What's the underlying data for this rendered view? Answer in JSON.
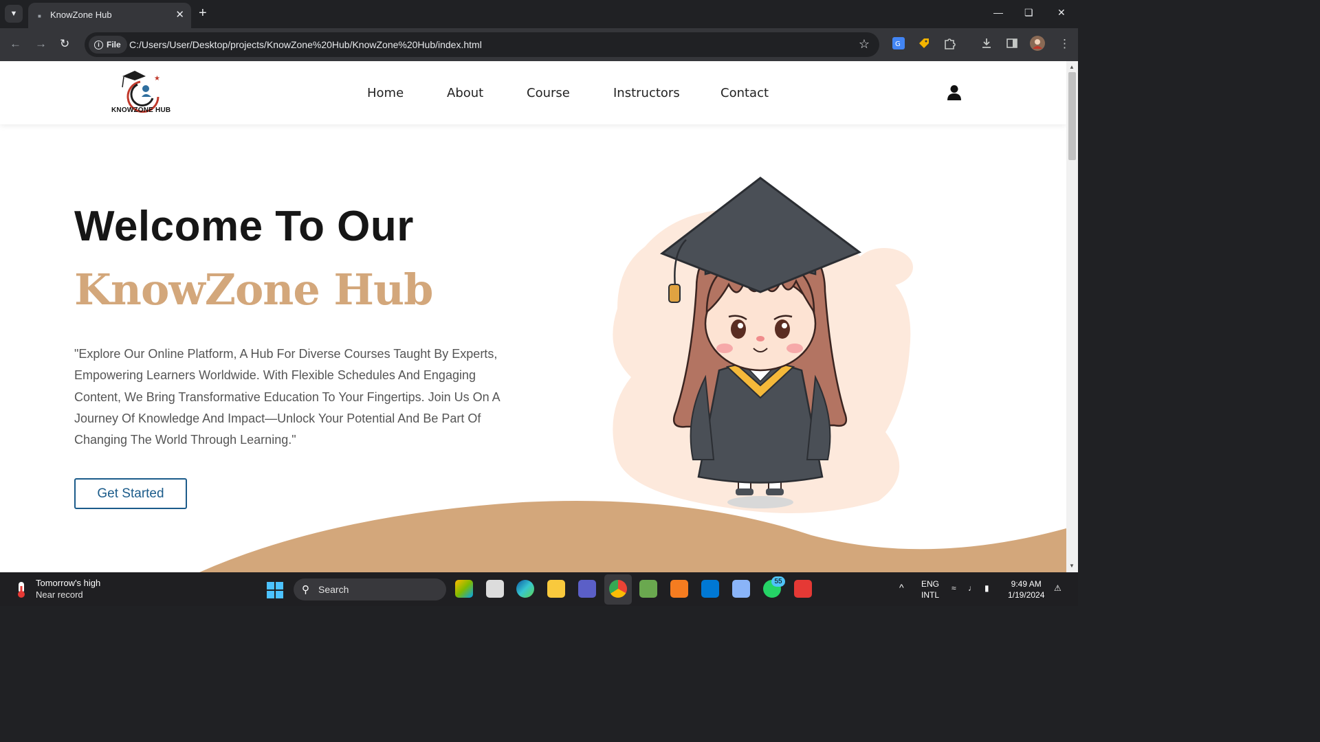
{
  "browser": {
    "tab_title": "KnowZone Hub",
    "new_tab_symbol": "+",
    "url_scheme_chip": "File",
    "url": "C:/Users/User/Desktop/projects/KnowZone%20Hub/KnowZone%20Hub/index.html"
  },
  "site": {
    "logo_text": "KNOWZONE HUB",
    "nav": [
      "Home",
      "About",
      "Course",
      "Instructors",
      "Contact"
    ],
    "hero": {
      "heading_line1": "Welcome To Our",
      "heading_line2": "KnowZone Hub",
      "paragraph": "\"Explore Our Online Platform, A Hub For Diverse Courses Taught By Experts, Empowering Learners Worldwide. With Flexible Schedules And Engaging Content, We Bring Transformative Education To Your Fingertips. Join Us On A Journey Of Knowledge And Impact—Unlock Your Potential And Be Part Of Changing The World Through Learning.\"",
      "cta_label": "Get Started"
    },
    "colors": {
      "accent": "#d3a77b",
      "button": "#1b5b8a",
      "blob": "#fde9dc"
    }
  },
  "taskbar": {
    "weather_line1": "Tomorrow's high",
    "weather_line2": "Near record",
    "search_label": "Search",
    "whatsapp_badge": "55",
    "lang_line1": "ENG",
    "lang_line2": "INTL",
    "time": "9:49 AM",
    "date": "1/19/2024"
  }
}
